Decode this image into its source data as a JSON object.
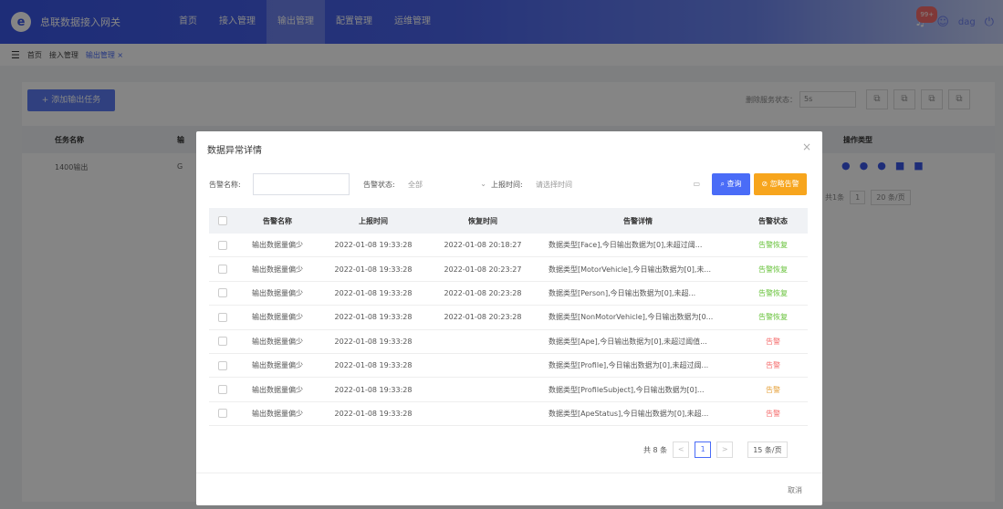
{
  "app": {
    "title": "息联数据接入网关",
    "logo_icon": "logo-icon"
  },
  "nav": [
    {
      "label": "首页",
      "active": false
    },
    {
      "label": "接入管理",
      "active": false
    },
    {
      "label": "输出管理",
      "active": true
    },
    {
      "label": "配置管理",
      "active": false
    },
    {
      "label": "运维管理",
      "active": false
    }
  ],
  "header": {
    "badge": "99+",
    "username": "dag"
  },
  "breadcrumb": {
    "items": [
      "首页",
      "接入管理",
      "输出管理 ×"
    ]
  },
  "page": {
    "add_button": "+ 添加输出任务",
    "status_filter_label": "删除服务状态：",
    "status_filter_value": "5s",
    "table_headers": {
      "name": "任务名称",
      "col2": "输",
      "ops": "操作类型"
    },
    "row": {
      "name": "1400输出",
      "col2": "G"
    },
    "pager": {
      "total": "共1条",
      "page": "1",
      "size": "20 条/页"
    }
  },
  "modal": {
    "title": "数据异常详情",
    "close": "×",
    "filters": {
      "name_label": "告警名称:",
      "name_placeholder": "",
      "status_label": "告警状态:",
      "status_value": "全部",
      "time_label": "上报时间:",
      "time_placeholder": "请选择时间",
      "search_label": "查询",
      "ignore_label": "忽略告警"
    },
    "columns": [
      "告警名称",
      "上报时间",
      "恢复时间",
      "告警详情",
      "告警状态"
    ],
    "rows": [
      {
        "name": "输出数据量偏少",
        "report": "2022-01-08 19:33:28",
        "recover": "2022-01-08 20:18:27",
        "detail": "数据类型[Face],今日输出数据为[0],未超过阈...",
        "status": "告警恢复",
        "status_type": "recovered"
      },
      {
        "name": "输出数据量偏少",
        "report": "2022-01-08 19:33:28",
        "recover": "2022-01-08 20:23:27",
        "detail": "数据类型[MotorVehicle],今日输出数据为[0],未...",
        "status": "告警恢复",
        "status_type": "recovered"
      },
      {
        "name": "输出数据量偏少",
        "report": "2022-01-08 19:33:28",
        "recover": "2022-01-08 20:23:28",
        "detail": "数据类型[Person],今日输出数据为[0],未超...",
        "status": "告警恢复",
        "status_type": "recovered"
      },
      {
        "name": "输出数据量偏少",
        "report": "2022-01-08 19:33:28",
        "recover": "2022-01-08 20:23:28",
        "detail": "数据类型[NonMotorVehicle],今日输出数据为[0...",
        "status": "告警恢复",
        "status_type": "recovered"
      },
      {
        "name": "输出数据量偏少",
        "report": "2022-01-08 19:33:28",
        "recover": "",
        "detail": "数据类型[Ape],今日输出数据为[0],未超过阈值...",
        "status": "告警",
        "status_type": "alarm"
      },
      {
        "name": "输出数据量偏少",
        "report": "2022-01-08 19:33:28",
        "recover": "",
        "detail": "数据类型[Profile],今日输出数据为[0],未超过阈...",
        "status": "告警",
        "status_type": "alarm"
      },
      {
        "name": "输出数据量偏少",
        "report": "2022-01-08 19:33:28",
        "recover": "",
        "detail": "数据类型[ProfileSubject],今日输出数据为[0]...",
        "status": "告警",
        "status_type": "warn"
      },
      {
        "name": "输出数据量偏少",
        "report": "2022-01-08 19:33:28",
        "recover": "",
        "detail": "数据类型[ApeStatus],今日输出数据为[0],未超...",
        "status": "告警",
        "status_type": "alarm"
      }
    ],
    "pager": {
      "total": "共 8 条",
      "prev": "<",
      "page": "1",
      "next": ">",
      "size": "15 条/页"
    },
    "cancel": "取消"
  },
  "colors": {
    "primary": "#4a6cf7",
    "orange": "#f7a51d",
    "recovered": "#67c23a",
    "alarm": "#f56c6c"
  }
}
